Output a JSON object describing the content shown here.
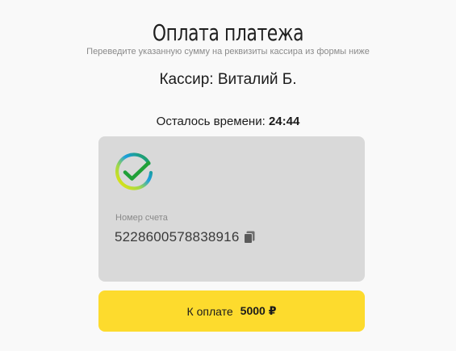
{
  "header": {
    "title": "Оплата платежа",
    "subtitle": "Переведите указанную сумму на реквизиты кассира из формы ниже"
  },
  "cashier": {
    "text": "Кассир: Виталий Б."
  },
  "timer": {
    "label": "Осталось времени:",
    "value": "24:44"
  },
  "card": {
    "bank_logo_icon": "bank-checkmark-logo-icon",
    "account_label": "Номер счета",
    "account_number": "5228600578838916",
    "copy_icon": "copy-icon"
  },
  "payment": {
    "label": "К оплате",
    "amount": "5000 ₽"
  },
  "colors": {
    "background": "#f9f9f9",
    "card_background": "#d9d9d9",
    "button_accent": "#fddb2d",
    "logo_green": "#21a038",
    "logo_blue": "#1a9ee0",
    "logo_yellow": "#f2e600"
  }
}
